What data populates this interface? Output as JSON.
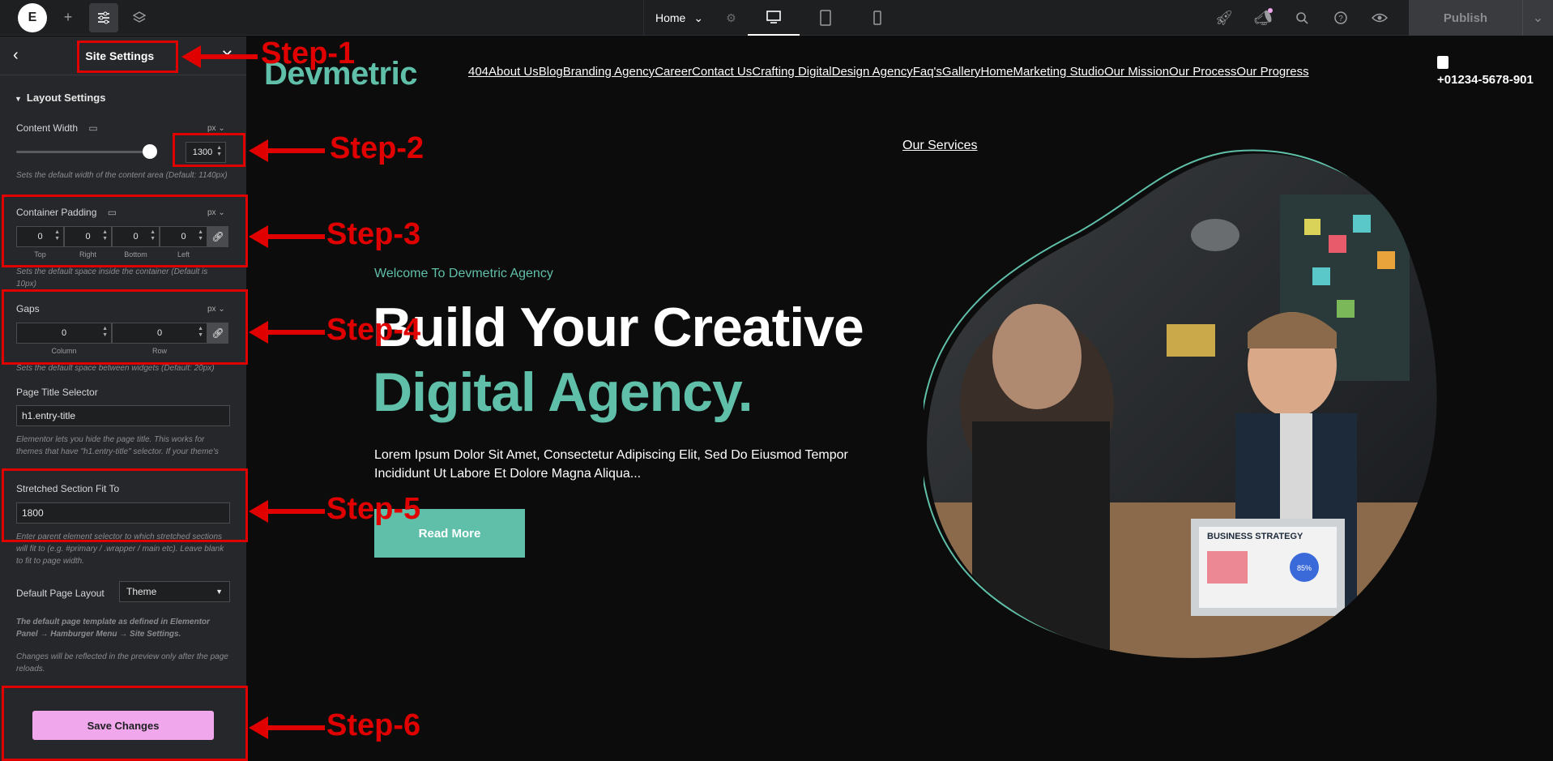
{
  "topbar": {
    "logo": "E",
    "page_name": "Home",
    "publish_label": "Publish"
  },
  "panel": {
    "title": "Site Settings",
    "section_title": "Layout Settings",
    "content_width": {
      "label": "Content Width",
      "unit": "px",
      "value": "1300",
      "help": "Sets the default width of the content area (Default: 1140px)"
    },
    "container_padding": {
      "label": "Container Padding",
      "unit": "px",
      "values": [
        "0",
        "0",
        "0",
        "0"
      ],
      "labels": [
        "Top",
        "Right",
        "Bottom",
        "Left"
      ],
      "help": "Sets the default space inside the container (Default is 10px)"
    },
    "gaps": {
      "label": "Gaps",
      "unit": "px",
      "values": [
        "0",
        "0"
      ],
      "labels": [
        "Column",
        "Row"
      ],
      "help": "Sets the default space between widgets (Default: 20px)"
    },
    "page_title_selector": {
      "label": "Page Title Selector",
      "value": "h1.entry-title",
      "help": "Elementor lets you hide the page title. This works for themes that have \"h1.entry-title\" selector. If your theme's selector is different, please enter it above."
    },
    "stretched_section": {
      "label": "Stretched Section Fit To",
      "value": "1800",
      "help": "Enter parent element selector to which stretched sections will fit to (e.g. #primary / .wrapper / main etc). Leave blank to fit to page width."
    },
    "default_layout": {
      "label": "Default Page Layout",
      "value": "Theme",
      "help": "The default page template as defined in Elementor Panel → Hamburger Menu → Site Settings."
    },
    "reload_note": "Changes will be reflected in the preview only after the page reloads.",
    "save_label": "Save Changes"
  },
  "preview": {
    "brand": "Devmetric",
    "nav": [
      "404",
      "About Us",
      "Blog",
      "Branding Agency",
      "Career",
      "Contact Us",
      "Crafting Digital",
      "Design Agency",
      "Faq's",
      "Gallery",
      "Home",
      "Marketing Studio",
      "Our Mission",
      "Our Process",
      "Our Progress"
    ],
    "phone": "+01234-5678-901",
    "services": "Our Services",
    "welcome": "Welcome To Devmetric Agency",
    "headline1": "Build Your Creative",
    "headline2": "Digital Agency.",
    "body": "Lorem Ipsum Dolor Sit Amet, Consectetur Adipiscing Elit, Sed Do Eiusmod Tempor Incididunt Ut Labore Et Dolore Magna Aliqua...",
    "cta": "Read More",
    "laptop_text": "BUSINESS STRATEGY",
    "laptop_percent": "85%"
  },
  "annotations": [
    "Step-1",
    "Step-2",
    "Step-3",
    "Step-4",
    "Step-5",
    "Step-6"
  ],
  "colors": {
    "accent": "#5fbfa9",
    "annotation": "#e00000",
    "save_button": "#f0a7ec"
  }
}
